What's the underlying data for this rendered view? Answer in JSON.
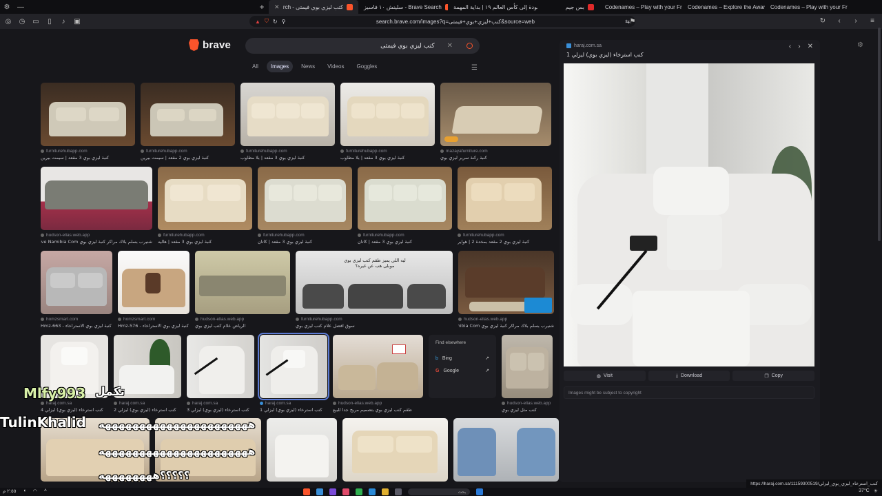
{
  "browser": {
    "tabs": [
      {
        "label": "كتب ليزي بوي فيمتى - Brave Search",
        "color": "#fb542b",
        "active": true
      },
      {
        "label": "سلينش ١٠ فاسيز - Brave Search",
        "color": "#fb542b"
      },
      {
        "label": "العودة إلى كأس العالم ١٩ | بداية المهمة",
        "color": "#e02a2a"
      },
      {
        "label": "بس جيم",
        "color": "#e02a2a"
      },
      {
        "label": "Codenames – Play with your Friends",
        "color": "#e0a030"
      },
      {
        "label": "Codenames – Explore the Award-Wi...",
        "color": "#e0a030"
      },
      {
        "label": "Codenames – Play with your Friends",
        "color": "#e0a030"
      }
    ],
    "url": "search.brave.com/images?q=كنب+ليزي+بوي+فيمتى&source=web"
  },
  "search": {
    "brand": "brave",
    "query": "كنب ليزي بوي فيمتى",
    "tabs": [
      "All",
      "Images",
      "News",
      "Videos",
      "Goggles"
    ],
    "active_tab": "Images"
  },
  "results": {
    "row1": [
      {
        "src": "furniturehubapp.com",
        "cap": "كنبة ليزي بوي 3 مقعد | سيمت بيرين"
      },
      {
        "src": "furniturehubapp.com",
        "cap": "كنبة ليزي بوي 2 مقعد | سيمت بيرين"
      },
      {
        "src": "furniturehubapp.com",
        "cap": "كنبة ليزي بوي 3 مقعد | بلا مطاوب"
      },
      {
        "src": "furniturehubapp.com",
        "cap": "كنبة ليزي بوي 3 مقعد | بلا مطاوب"
      },
      {
        "src": "mazayafurniture.com",
        "cap": "كنبة ركنة سرير ليزي بوي"
      }
    ],
    "row2": [
      {
        "src": "hudson-elias.web.app",
        "cap": "شنيرب بسلم بلاك مراكر كنبة ليزي بوي Self Drive Namibia Com"
      },
      {
        "src": "furniturehubapp.com",
        "cap": "كنبة ليزي بوي 3 مقعد | هاليه"
      },
      {
        "src": "furniturehubapp.com",
        "cap": "كنبة ليزي بوي 3 مقعد | كاتان"
      },
      {
        "src": "furniturehubapp.com",
        "cap": "كنبة ليزي بوي 3 مقعد | كاتان"
      },
      {
        "src": "furniturehubapp.com",
        "cap": "كنبة ليزي بوي 2 مقعد بمخدة 2 | هواير"
      }
    ],
    "row3": [
      {
        "src": "homzsmart.com",
        "cap": "كنبة ليزي بوي الاستراخاء - Hmz-663"
      },
      {
        "src": "homzsmart.com",
        "cap": "كنبة ليزي بوي الاستراخاء - Hmz-576"
      },
      {
        "src": "hudson-elias.web.app",
        "cap": "الرياض علام كتب ليزي بوي"
      },
      {
        "src": "furniturehubapp.com",
        "cap": "سوق افضل علام كنب ليزي بوي",
        "overlay": "ليه اللي يميز طقم كنب ليزي بوي\nموبلى هب عن غيره؟"
      },
      {
        "src": "hudson-elias.web.app",
        "cap": "شنيرب بسلم بلاك مراكر كنبة ليزي بوي Self Drive Namibia Com"
      }
    ],
    "row4": [
      {
        "src": "haraj.com.sa",
        "cap": "كنب استرخاء (ليزي بوي) ليزلي 4"
      },
      {
        "src": "haraj.com.sa",
        "cap": "كنب استرخاء (ليزي بوي) ليزلي 2"
      },
      {
        "src": "haraj.com.sa",
        "cap": "كنب استرخاء (ليزي بوي) ليزلي 3"
      },
      {
        "src": "haraj.com.sa",
        "cap": "كنب استرخاء (ليزي بوي) ليزلي 1"
      },
      {
        "src": "hudson-elias.web.app",
        "cap": "طقم كنب ليزي بوي بتصميم مريح جدا للبيع"
      },
      {
        "src": "hudson-elias.web.app",
        "cap": "كنب مثل ليزي بوي"
      }
    ],
    "find_elsewhere": {
      "title": "Find elsewhere",
      "items": [
        "Bing",
        "Google"
      ]
    }
  },
  "preview": {
    "source": "haraj.com.sa",
    "title": "كنب استرخاء (ليزي بوي) ليزلي 1",
    "actions": [
      "Visit",
      "Download",
      "Copy"
    ],
    "note": "Images might be subject to copyright"
  },
  "overlay": {
    "line1": "Mlfy993",
    "line1b": "تكمل",
    "line2": "TulinKhalid",
    "rep1": "ههههههههههههههههههههههه",
    "rep2": "ههههههههههههههههههههههه",
    "rep3": "؟؟؟؟؟ههههههههه"
  },
  "status_url": "https://haraj.com.sa/11159300519/كنب_استرخاء_ليزي_بوي_ليزلي",
  "taskbar": {
    "search_placeholder": "بحث",
    "temp": "37°C",
    "time": "٢:٥٥ م"
  }
}
